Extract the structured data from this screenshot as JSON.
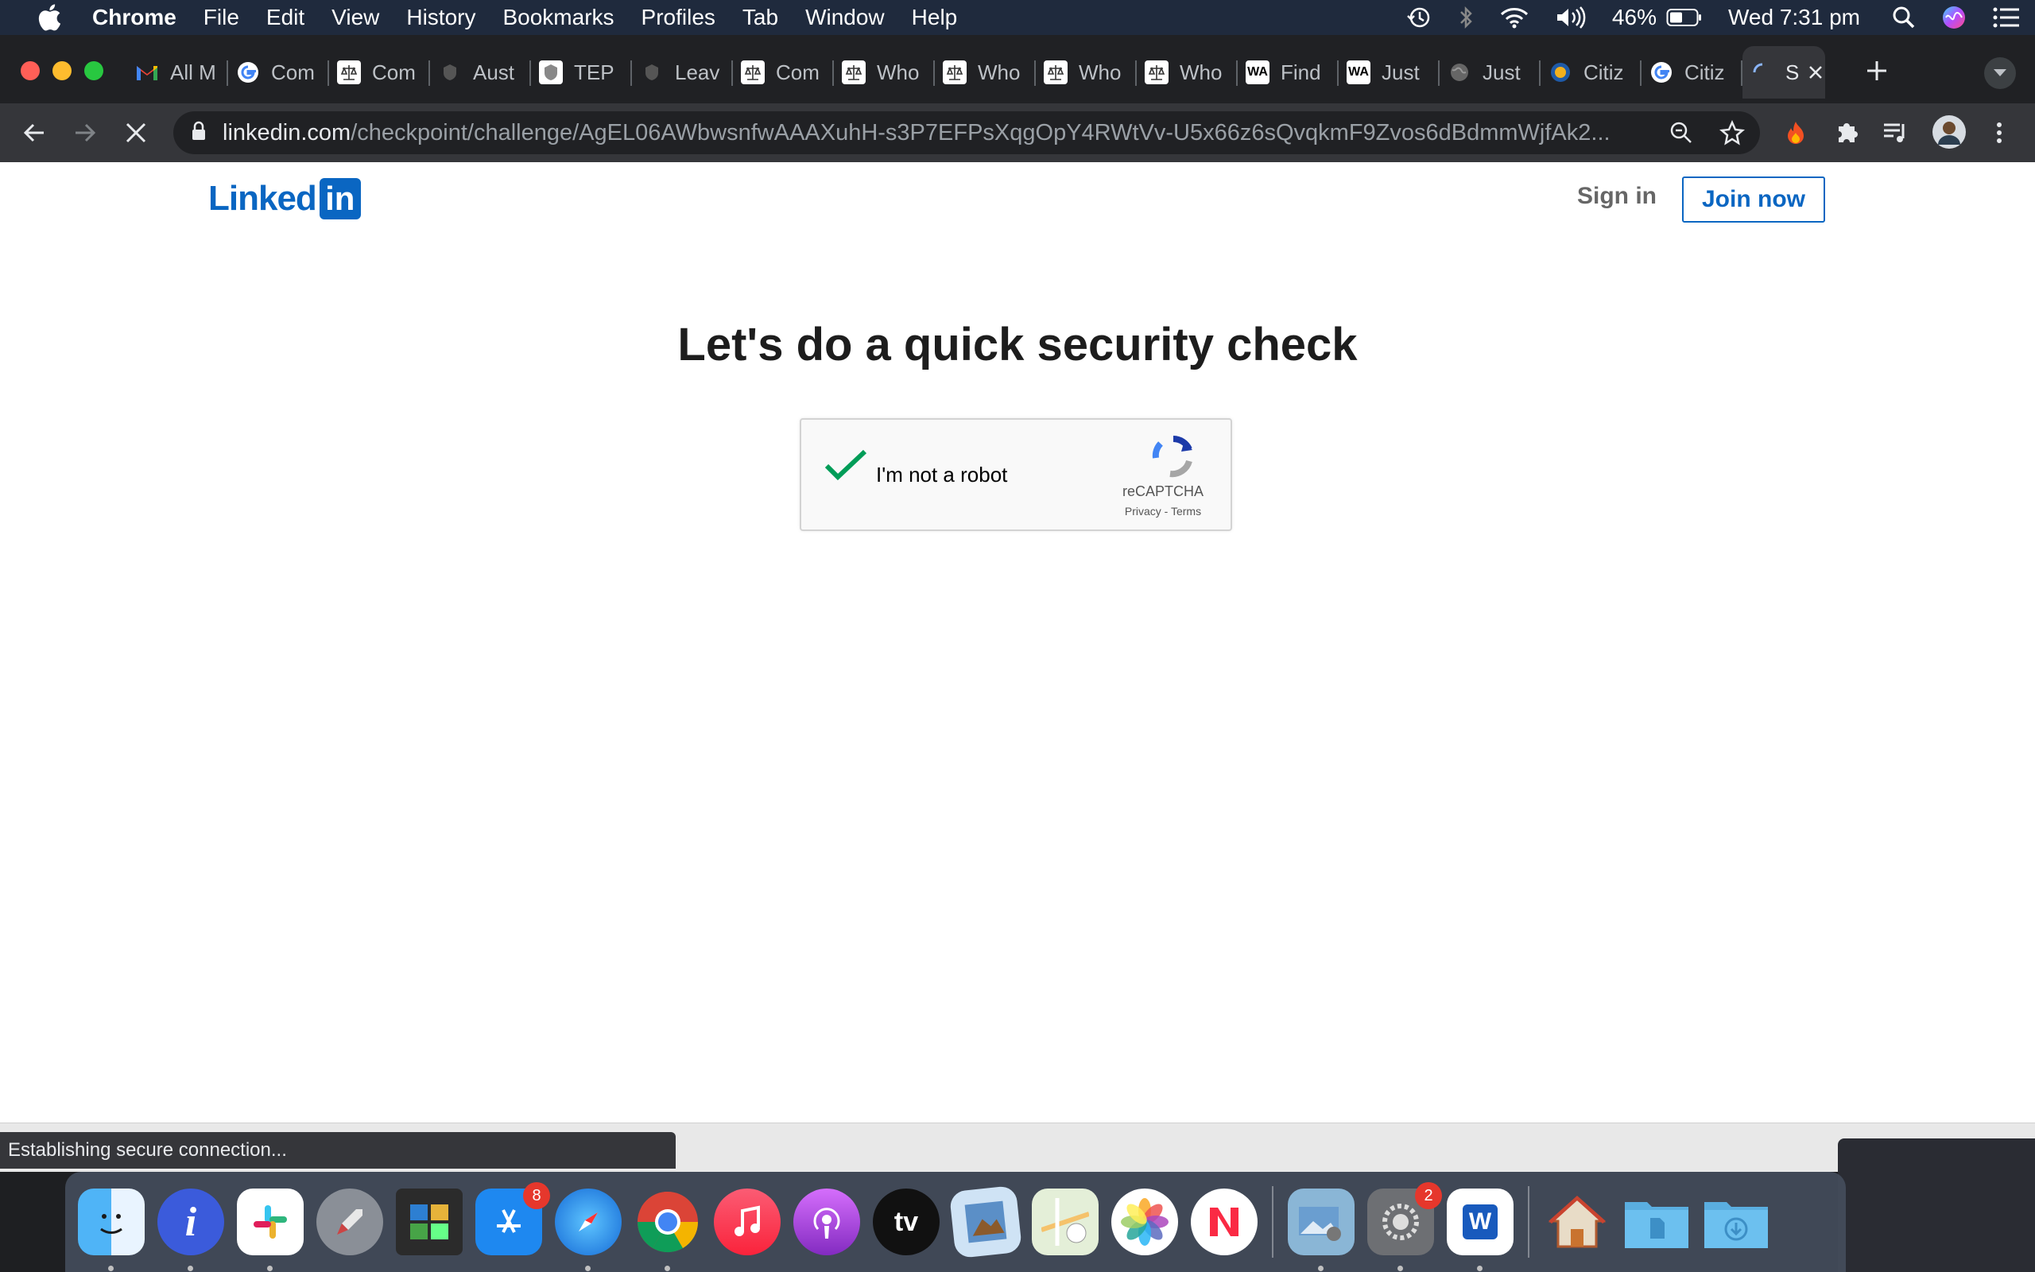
{
  "menubar": {
    "app": "Chrome",
    "items": [
      "File",
      "Edit",
      "View",
      "History",
      "Bookmarks",
      "Profiles",
      "Tab",
      "Window",
      "Help"
    ],
    "battery": "46%",
    "clock": "Wed 7:31 pm"
  },
  "tabs": [
    {
      "label": "All M",
      "icon": "gmail-icon"
    },
    {
      "label": "Com",
      "icon": "google-icon"
    },
    {
      "label": "Com",
      "icon": "scales-icon"
    },
    {
      "label": "Aust",
      "icon": "crest-icon"
    },
    {
      "label": "TEP",
      "icon": "crest-icon"
    },
    {
      "label": "Leav",
      "icon": "crest-icon"
    },
    {
      "label": "Com",
      "icon": "scales-icon"
    },
    {
      "label": "Who",
      "icon": "scales-icon"
    },
    {
      "label": "Who",
      "icon": "scales-icon"
    },
    {
      "label": "Who",
      "icon": "scales-icon"
    },
    {
      "label": "Who",
      "icon": "scales-icon"
    },
    {
      "label": "Find",
      "icon": "wa-icon",
      "badge": "WA"
    },
    {
      "label": "Just",
      "icon": "wa-icon",
      "badge": "WA"
    },
    {
      "label": "Just",
      "icon": "globe-icon"
    },
    {
      "label": "Citiz",
      "icon": "seal-icon"
    },
    {
      "label": "Citiz",
      "icon": "google-icon"
    },
    {
      "label": "S",
      "icon": "loading-icon",
      "active": true
    }
  ],
  "toolbar": {
    "url_host": "linkedin.com",
    "url_path": "/checkpoint/challenge/AgEL06AWbwsnfwAAAXuhH-s3P7EFPsXqgOpY4RWtVv-U5x66z6sQvqkmF9Zvos6dBdmmWjfAk2..."
  },
  "page": {
    "logo_word": "Linked",
    "logo_box": "in",
    "sign_in": "Sign in",
    "join_now": "Join now",
    "title": "Let's do a quick security check",
    "recaptcha": {
      "label": "I'm not a robot",
      "brand": "reCAPTCHA",
      "privacy": "Privacy",
      "separator": " - ",
      "terms": "Terms"
    }
  },
  "status": "Establishing secure connection...",
  "dock": {
    "apps": [
      {
        "name": "finder"
      },
      {
        "name": "info"
      },
      {
        "name": "slack"
      },
      {
        "name": "launchpad"
      },
      {
        "name": "photo-booth"
      },
      {
        "name": "app-store",
        "badge": "8"
      },
      {
        "name": "safari"
      },
      {
        "name": "chrome"
      },
      {
        "name": "music"
      },
      {
        "name": "podcasts"
      },
      {
        "name": "apple-tv",
        "text": "tv"
      },
      {
        "name": "preview"
      },
      {
        "name": "maps"
      },
      {
        "name": "photos"
      },
      {
        "name": "news"
      },
      {
        "name": "image-capture"
      },
      {
        "name": "system-preferences",
        "badge": "2"
      },
      {
        "name": "word",
        "text": "W"
      },
      {
        "name": "home-folder"
      },
      {
        "name": "documents-folder"
      },
      {
        "name": "downloads-folder"
      }
    ]
  },
  "colors": {
    "linkedin_blue": "#0a66c2",
    "recaptcha_check": "#009d58"
  }
}
